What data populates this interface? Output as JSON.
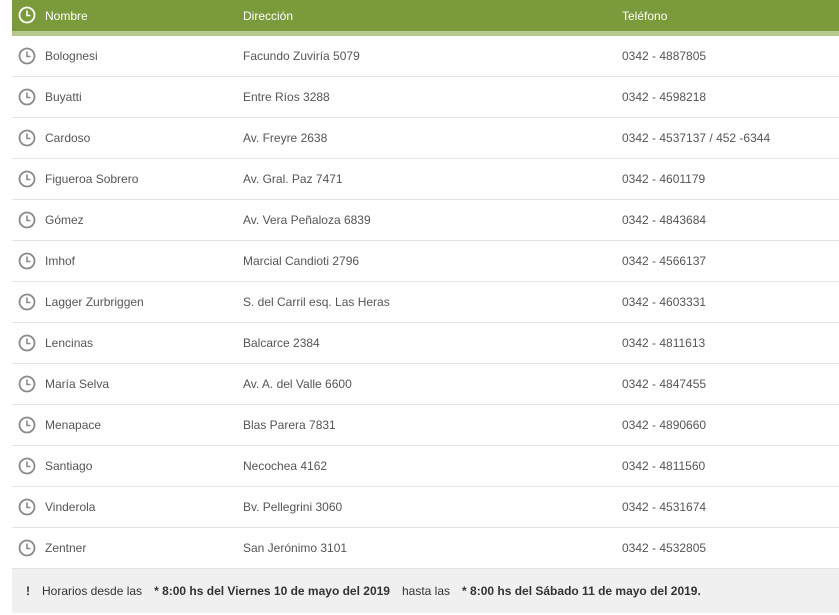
{
  "header": {
    "name": "Nombre",
    "address": "Dirección",
    "phone": "Teléfono"
  },
  "rows": [
    {
      "name": "Bolognesi",
      "address": "Facundo Zuviría 5079",
      "phone": "0342 - 4887805"
    },
    {
      "name": "Buyatti",
      "address": "Entre Ríos 3288",
      "phone": "0342 - 4598218"
    },
    {
      "name": "Cardoso",
      "address": "Av. Freyre 2638",
      "phone": "0342 - 4537137 / 452 -6344"
    },
    {
      "name": "Figueroa Sobrero",
      "address": "Av. Gral. Paz 7471",
      "phone": "0342 - 4601179"
    },
    {
      "name": "Gómez",
      "address": "Av. Vera Peñaloza 6839",
      "phone": "0342 - 4843684"
    },
    {
      "name": "Imhof",
      "address": "Marcial Candioti 2796",
      "phone": "0342 - 4566137"
    },
    {
      "name": "Lagger Zurbriggen",
      "address": "S. del Carril esq. Las Heras",
      "phone": "0342 - 4603331"
    },
    {
      "name": "Lencinas",
      "address": "Balcarce 2384",
      "phone": "0342 - 4811613"
    },
    {
      "name": "María Selva",
      "address": "Av. A. del Valle 6600",
      "phone": "0342 - 4847455"
    },
    {
      "name": "Menapace",
      "address": "Blas Parera 7831",
      "phone": "0342 - 4890660"
    },
    {
      "name": "Santiago",
      "address": "Necochea 4162",
      "phone": "0342 - 4811560"
    },
    {
      "name": "Vinderola",
      "address": "Bv. Pellegrini 3060",
      "phone": "0342 - 4531674"
    },
    {
      "name": "Zentner",
      "address": "San Jerónimo 3101",
      "phone": "0342 - 4532805"
    }
  ],
  "footer": {
    "mark": "!",
    "prefix": "Horarios desde las",
    "from": "* 8:00 hs del Viernes 10 de mayo del 2019",
    "middle": "hasta las",
    "to": "* 8:00 hs del Sábado 11 de mayo del 2019."
  },
  "colors": {
    "header_bg": "#7a9a3c",
    "header_rule": "#b6c98a",
    "icon": "#8a8a8a"
  },
  "icons": {
    "row": "clock-icon",
    "header": "clock-icon"
  }
}
